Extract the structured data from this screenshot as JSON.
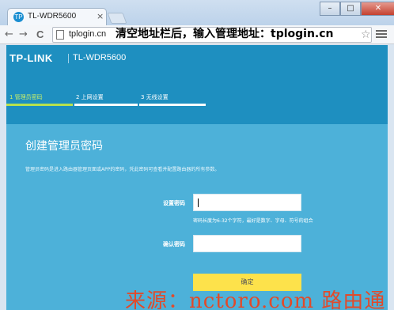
{
  "browser": {
    "tab_title": "TL-WDR5600",
    "tab_favicon_text": "TP",
    "tab_close": "×",
    "url": "tplogin.cn",
    "annotation": "清空地址栏后，输入管理地址：tplogin.cn",
    "window_controls": {
      "minimize": "–",
      "maximize": "□",
      "close": "✕"
    },
    "nav": {
      "back": "←",
      "forward": "→",
      "reload": "C"
    },
    "star": "☆"
  },
  "page": {
    "logo": "TP-LINK",
    "model": "TL-WDR5600",
    "steps": [
      {
        "label": "1 管理员密码",
        "active": true
      },
      {
        "label": "2 上网设置",
        "active": false
      },
      {
        "label": "3 无线设置",
        "active": false
      }
    ],
    "title": "创建管理员密码",
    "description": "管理员密码是进入路由器管理页面或APP的密码，凭此密码可查看并配置路由器的所有参数。",
    "password_label": "设置密码",
    "password_hint": "密码长度为6-32个字符，最好是数字、字母、符号的组合",
    "confirm_label": "确认密码",
    "confirm_button": "确定"
  },
  "watermark": "来源：nctoro.com 路由通",
  "colors": {
    "header": "#1e8fc0",
    "card": "#4db1d9",
    "active_step": "#b7e24d",
    "button": "#fde24b",
    "watermark": "#e24a2a"
  }
}
